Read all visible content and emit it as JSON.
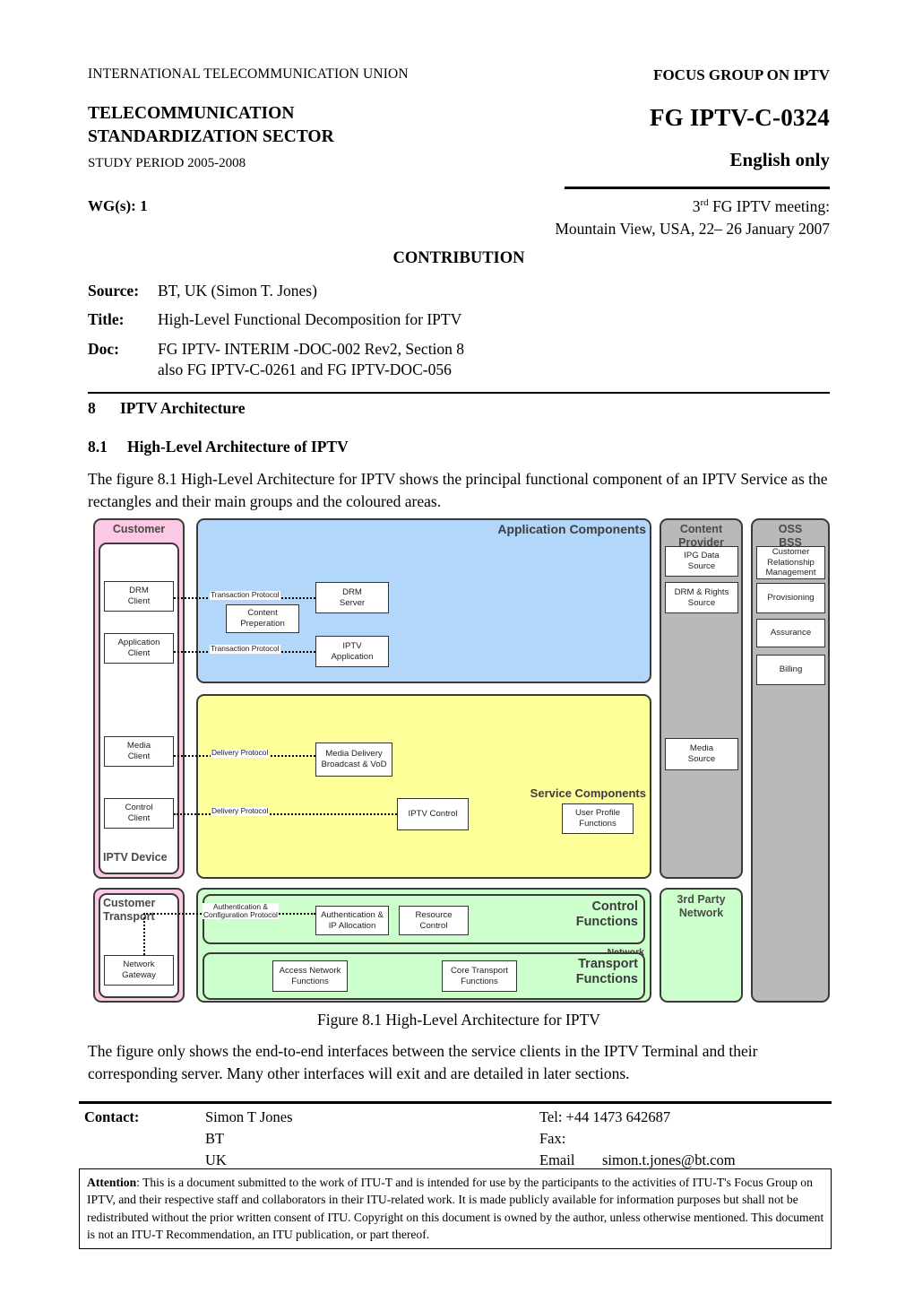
{
  "header": {
    "itu_line": "INTERNATIONAL TELECOMMUNICATION UNION",
    "focus_group": "FOCUS GROUP ON IPTV",
    "sector_line1": "TELECOMMUNICATION",
    "sector_line2": "STANDARDIZATION SECTOR",
    "doc_number": "FG IPTV-C-0324",
    "study_period": "STUDY PERIOD 2005-2008",
    "language": "English only",
    "wgs": "WG(s): 1",
    "meeting_line1_pre": "3",
    "meeting_line1_ord": "rd",
    "meeting_line1_post": " FG IPTV meeting:",
    "meeting_line2": "Mountain View, USA, 22– 26 January 2007",
    "contribution": "CONTRIBUTION"
  },
  "meta": {
    "source_label": "Source:",
    "source_value": "BT, UK (Simon T. Jones)",
    "title_label": "Title:",
    "title_value": "High-Level Functional Decomposition for IPTV",
    "doc_label": "Doc:",
    "doc_value_line1": "FG IPTV- INTERIM -DOC-002 Rev2, Section  8",
    "doc_value_line2": "also FG IPTV-C-0261 and FG IPTV-DOC-056"
  },
  "sections": {
    "h1_num": "8",
    "h1_text": "IPTV Architecture",
    "h2_num": "8.1",
    "h2_text": "High-Level Architecture of IPTV",
    "intro_paragraph": "The figure 8.1 High-Level Architecture for IPTV shows the principal functional component of an IPTV Service as the rectangles and their main groups and the coloured areas.",
    "figure_caption": "Figure 8.1 High-Level Architecture for IPTV",
    "after_paragraph": "The figure only shows the end-to-end interfaces between the service clients in the IPTV Terminal and their corresponding server. Many other interfaces will exit and are detailed in later sections."
  },
  "diagram": {
    "zones": {
      "customer": "Customer",
      "iptv_device": "IPTV Device",
      "customer_transport_l1": "Customer",
      "customer_transport_l2": "Transport",
      "application_components": "Application Components",
      "service_components": "Service Components",
      "content_provider_l1": "Content",
      "content_provider_l2": "Provider",
      "oss_l1": "OSS",
      "oss_l2": "BSS",
      "third_party_l1": "3rd Party",
      "third_party_l2": "Network",
      "control_functions_l1": "Control",
      "control_functions_l2": "Functions",
      "transport_functions_l1": "Transport",
      "transport_functions_l2": "Functions",
      "network_label": "Network"
    },
    "nodes": {
      "drm_client_l1": "DRM",
      "drm_client_l2": "Client",
      "application_client_l1": "Application",
      "application_client_l2": "Client",
      "media_client_l1": "Media",
      "media_client_l2": "Client",
      "control_client_l1": "Control",
      "control_client_l2": "Client",
      "network_gateway_l1": "Network",
      "network_gateway_l2": "Gateway",
      "drm_server_l1": "DRM",
      "drm_server_l2": "Server",
      "content_preparation_l1": "Content",
      "content_preparation_l2": "Preperation",
      "iptv_application_l1": "IPTV",
      "iptv_application_l2": "Application",
      "media_delivery_l1": "Media Delivery",
      "media_delivery_l2": "Broadcast & VoD",
      "iptv_control": "IPTV Control",
      "user_profile_l1": "User Profile",
      "user_profile_l2": "Functions",
      "ipg_data_l1": "IPG Data",
      "ipg_data_l2": "Source",
      "drm_rights_l1": "DRM  & Rights",
      "drm_rights_l2": "Source",
      "media_source_l1": "Media",
      "media_source_l2": "Source",
      "crm_l1": "Customer",
      "crm_l2": "Relationship",
      "crm_l3": "Management",
      "provisioning": "Provisioning",
      "assurance": "Assurance",
      "billing": "Billing",
      "auth_ip_alloc_l1": "Authentication  &",
      "auth_ip_alloc_l2": "IP Allocation",
      "resource_control_l1": "Resource",
      "resource_control_l2": "Control",
      "access_network_l1": "Access Network",
      "access_network_l2": "Functions",
      "core_transport_l1": "Core Transport",
      "core_transport_l2": "Functions"
    },
    "protocols": {
      "transaction_1": "Transaction Protocol",
      "transaction_2": "Transaction Protocol",
      "delivery_1": "Delivery Protocol",
      "delivery_2": "Delivery Protocol",
      "auth_config_l1": "Authentication  &",
      "auth_config_l2": "Configuration Protocol"
    },
    "colors": {
      "customer": "#fbc9e3",
      "application": "#b3d7fb",
      "service": "#ffff99",
      "network": "#ccffcc",
      "provider": "#b9b9b9"
    }
  },
  "contact": {
    "label": "Contact:",
    "name": "Simon T Jones",
    "org": "BT",
    "country": "UK",
    "tel": "Tel: +44 1473 642687",
    "fax": "Fax:",
    "email_label": "Email",
    "email": "simon.t.jones@bt.com"
  },
  "attention": {
    "label": "Attention",
    "text": ": This is a document submitted to the work of ITU-T and is intended for use by the participants to the activities of ITU-T's Focus Group on IPTV, and their respective staff and collaborators in their ITU-related work.  It is made publicly available for information purposes but shall not be redistributed without the prior written consent of ITU.  Copyright on this document is owned by the author, unless otherwise mentioned.  This document is not an ITU-T Recommendation, an ITU publication, or part thereof."
  }
}
